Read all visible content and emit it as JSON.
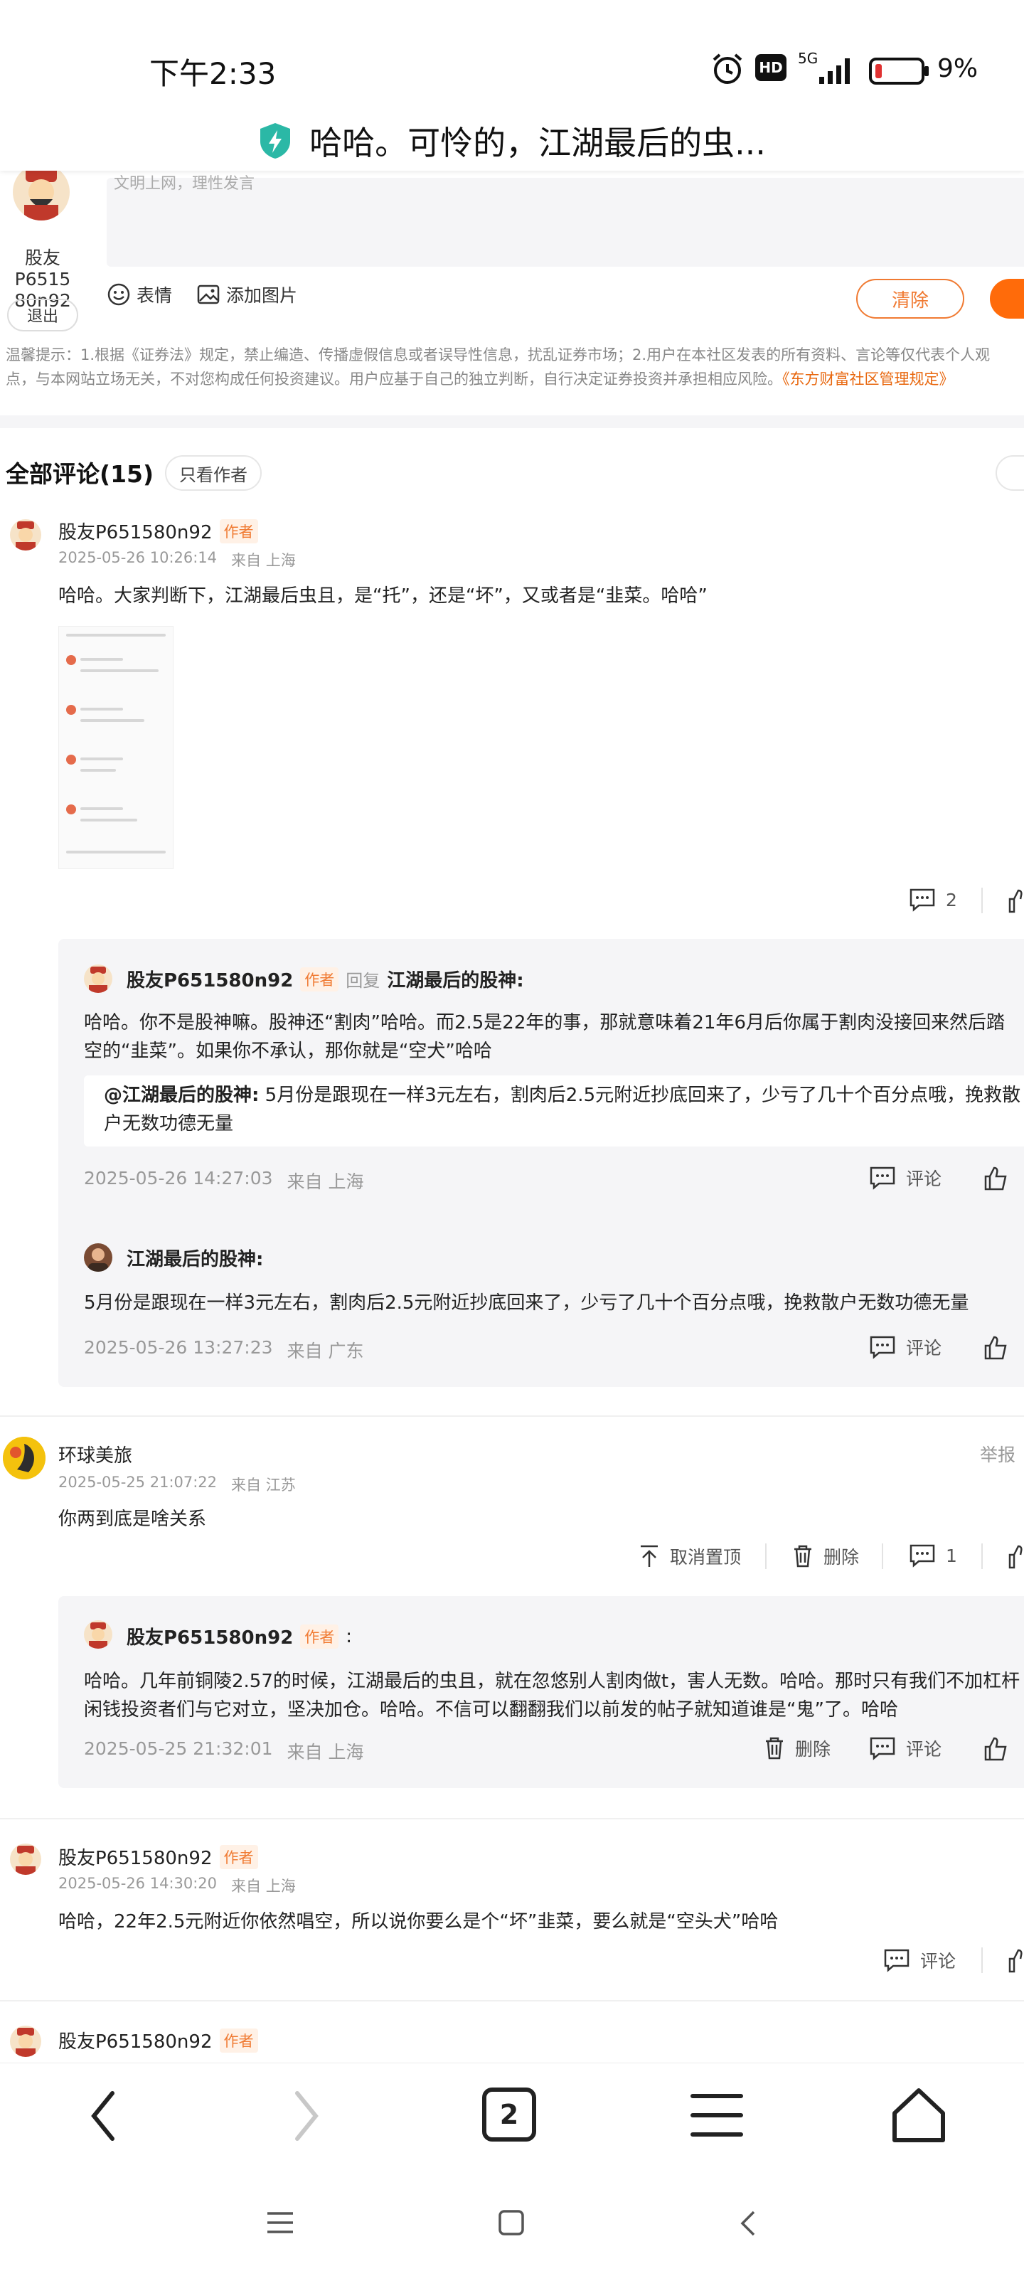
{
  "status_bar": {
    "time": "下午2:33",
    "hd": "HD",
    "network": "5G",
    "battery": "9%"
  },
  "header": {
    "title": "哈哈。可怜的，江湖最后的虫..."
  },
  "editor": {
    "user_nick": "股友P6515\n80n92",
    "placeholder": "文明上网，理性发言",
    "emoji_label": "表情",
    "image_label": "添加图片",
    "clear_label": "清除",
    "logout_label": "退出"
  },
  "notice": {
    "text": "温馨提示：1.根据《证券法》规定，禁止编造、传播虚假信息或者误导性信息，扰乱证券市场；2.用户在本社区发表的所有资料、言论等仅代表个人观点，与本网站立场无关，不对您构成任何投资建议。用户应基于自己的独立判断，自行决定证券投资并承担相应风险。",
    "link": "《东方财富社区管理规定》"
  },
  "comments_header": {
    "title": "全部评论(15)",
    "only_author": "只看作者"
  },
  "comments": [
    {
      "user": "股友P651580n92",
      "badge": "作者",
      "time": "2025-05-26 10:26:14",
      "location": "来自 上海",
      "text": "哈哈。大家判断下，江湖最后虫且，是“托”，还是“坏”，又或者是“韭菜。哈哈”",
      "reply_count": "2",
      "replies": [
        {
          "user": "股友P651580n92",
          "badge": "作者",
          "reply_word": "回复",
          "reply_to": "江湖最后的股神:",
          "text": "哈哈。你不是股神嘛。股神还“割肉”哈哈。而2.5是22年的事，那就意味着21年6月后你属于割肉没接回来然后踏空的“韭菜”。如果你不承认，那你就是“空犬”哈哈",
          "quote_user": "@江湖最后的股神:",
          "quote_text": "5月份是跟现在一样3元左右，割肉后2.5元附近抄底回来了，少亏了几十个百分点哦，挽救散户无数功德无量",
          "time": "2025-05-26 14:27:03",
          "location": "来自 上海",
          "comment_label": "评论"
        },
        {
          "user": "江湖最后的股神:",
          "text": "5月份是跟现在一样3元左右，割肉后2.5元附近抄底回来了，少亏了几十个百分点哦，挽救散户无数功德无量",
          "time": "2025-05-26 13:27:23",
          "location": "来自 广东",
          "comment_label": "评论"
        }
      ]
    },
    {
      "user": "环球美旅",
      "report": "举报",
      "time": "2025-05-25 21:07:22",
      "location": "来自 江苏",
      "text": "你两到底是啥关系",
      "unpin_label": "取消置顶",
      "delete_label": "删除",
      "reply_count": "1",
      "replies": [
        {
          "user": "股友P651580n92",
          "badge": "作者",
          "colon": ":",
          "text": "哈哈。几年前铜陵2.57的时候，江湖最后的虫且，就在忽悠别人割肉做t，害人无数。哈哈。那时只有我们不加杠杆闲钱投资者们与它对立，坚决加仓。哈哈。不信可以翻翻我们以前发的帖子就知道谁是“鬼”了。哈哈",
          "time": "2025-05-25 21:32:01",
          "location": "来自 上海",
          "delete_label": "删除",
          "comment_label": "评论"
        }
      ]
    },
    {
      "user": "股友P651580n92",
      "badge": "作者",
      "time": "2025-05-26 14:30:20",
      "location": "来自 上海",
      "text": "哈哈，22年2.5元附近你依然唱空，所以说你要么是个“坏”韭菜，要么就是“空头犬”哈哈",
      "comment_label": "评论"
    },
    {
      "user": "股友P651580n92",
      "badge": "作者"
    }
  ],
  "browser_nav": {
    "tab_count": "2"
  },
  "colors": {
    "accent": "#ff6b0a",
    "author_badge": "#f07a32"
  }
}
